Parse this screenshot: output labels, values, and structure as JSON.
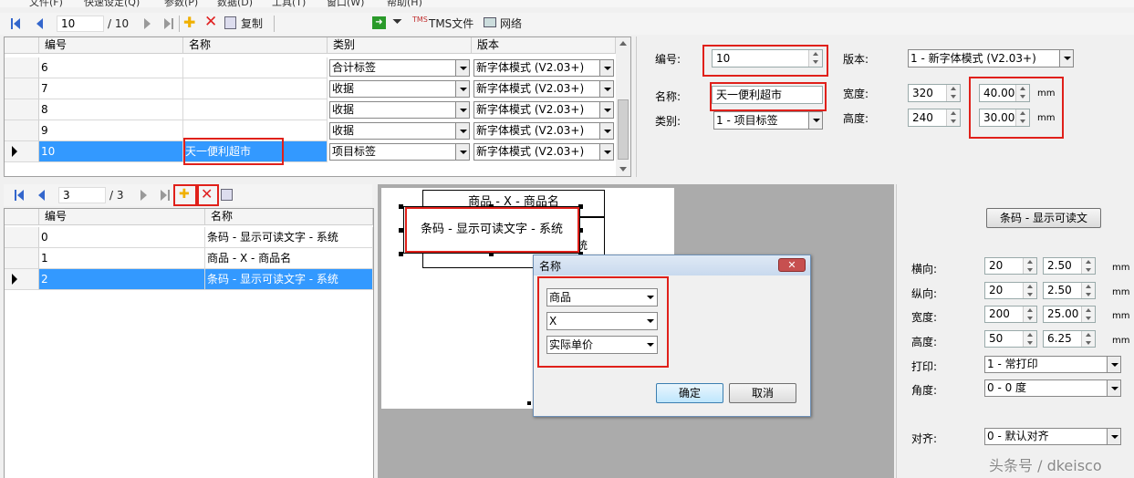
{
  "menu": [
    "文件(F)",
    "快速设定(Q)",
    "参数(P)",
    "数据(D)",
    "工具(T)",
    "窗口(W)",
    "帮助(H)"
  ],
  "top_toolbar": {
    "current": "10",
    "total": "/ 10",
    "copy_label": "复制",
    "tms_label": "TMS文件",
    "network_label": "网络"
  },
  "top_grid": {
    "headers": [
      "编号",
      "名称",
      "类别",
      "版本"
    ],
    "rows": [
      {
        "id": "6",
        "name": "",
        "type": "合计标签",
        "version": "新字体模式 (V2.03+)"
      },
      {
        "id": "7",
        "name": "",
        "type": "收据",
        "version": "新字体模式 (V2.03+)"
      },
      {
        "id": "8",
        "name": "",
        "type": "收据",
        "version": "新字体模式 (V2.03+)"
      },
      {
        "id": "9",
        "name": "",
        "type": "收据",
        "version": "新字体模式 (V2.03+)"
      },
      {
        "id": "10",
        "name": "天一便利超市",
        "type": "项目标签",
        "version": "新字体模式 (V2.03+)"
      }
    ]
  },
  "props": {
    "id_label": "编号:",
    "id_value": "10",
    "version_label": "版本:",
    "version_value": "1 - 新字体模式 (V2.03+)",
    "name_label": "名称:",
    "name_value": "天一便利超市",
    "type_label": "类别:",
    "type_value": "1 - 项目标签",
    "width_label": "宽度:",
    "width_px": "320",
    "width_mm": "40.00",
    "height_label": "高度:",
    "height_px": "240",
    "height_mm": "30.00",
    "unit": "mm"
  },
  "bottom_toolbar": {
    "current": "3",
    "total": "/ 3"
  },
  "bottom_grid": {
    "headers": [
      "编号",
      "名称"
    ],
    "rows": [
      {
        "id": "0",
        "name": "条码 - 显示可读文字 - 系统"
      },
      {
        "id": "1",
        "name": "商品 - X - 商品名"
      },
      {
        "id": "2",
        "name": "条码 - 显示可读文字 - 系统"
      }
    ]
  },
  "canvas": {
    "item1": "商品 - X - 商品名",
    "item2": "条码 - 显示可读文字 - 系统",
    "item2_tail": "统"
  },
  "dialog": {
    "title": "名称",
    "combo1": "商品",
    "combo2": "X",
    "combo3": "实际单价",
    "ok": "确定",
    "cancel": "取消"
  },
  "right_panel": {
    "element_button": "条码 - 显示可读文",
    "h_label": "横向:",
    "h_px": "20",
    "h_mm": "2.50",
    "v_label": "纵向:",
    "v_px": "20",
    "v_mm": "2.50",
    "w_label": "宽度:",
    "w_px": "200",
    "w_mm": "25.00",
    "ht_label": "高度:",
    "ht_px": "50",
    "ht_mm": "6.25",
    "print_label": "打印:",
    "print_value": "1 - 常打印",
    "angle_label": "角度:",
    "angle_value": "0 - 0 度",
    "align_label": "对齐:",
    "align_value": "0 - 默认对齐",
    "unit": "mm"
  },
  "watermark": "头条号 / dkeisco",
  "colors": {
    "selection": "#3399ff",
    "highlight_box": "#e0201a",
    "add_icon": "#f0b000",
    "delete_icon": "#e02020",
    "go_icon": "#2a9a2a"
  }
}
